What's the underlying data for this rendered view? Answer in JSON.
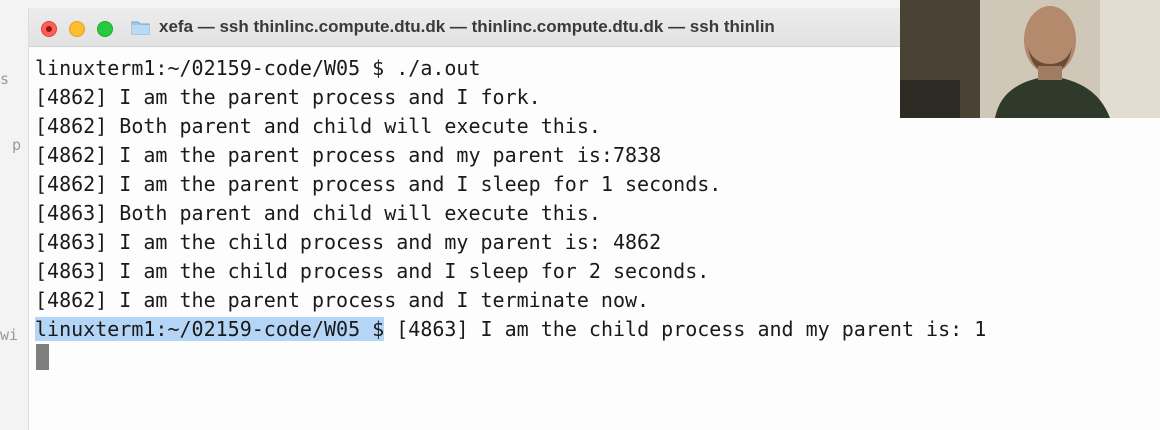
{
  "window": {
    "title": "xefa — ssh thinlinc.compute.dtu.dk — thinlinc.compute.dtu.dk — ssh thinlin"
  },
  "background_window": {
    "edge_chars": [
      "s",
      "p",
      "wi"
    ]
  },
  "terminal": {
    "lines": [
      "linuxterm1:~/02159-code/W05 $ ./a.out",
      "[4862] I am the parent process and I fork.",
      "[4862] Both parent and child will execute this.",
      "[4862] I am the parent process and my parent is:7838",
      "[4862] I am the parent process and I sleep for 1 seconds.",
      "[4863] Both parent and child will execute this.",
      "[4863] I am the child process and my parent is: 4862",
      "[4863] I am the child process and I sleep for 2 seconds.",
      "[4862] I am the parent process and I terminate now."
    ],
    "last_prompt": "linuxterm1:~/02159-code/W05 $",
    "last_output": " [4863] I am the child process and my parent is: 1"
  },
  "colors": {
    "close": "#ff5f57",
    "minimize": "#febc2e",
    "maximize": "#28c840",
    "selection": "#b5d5f7"
  },
  "icons": {
    "folder": "folder-icon"
  }
}
